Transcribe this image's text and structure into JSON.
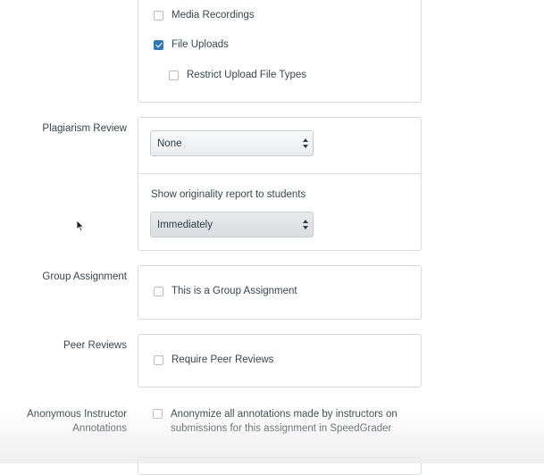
{
  "submission_types": {
    "media_recordings_label": "Media Recordings",
    "media_recordings_checked": false,
    "file_uploads_label": "File Uploads",
    "file_uploads_checked": true,
    "restrict_upload_label": "Restrict Upload File Types",
    "restrict_upload_checked": false
  },
  "plagiarism": {
    "label": "Plagiarism Review",
    "selected": "None",
    "originality_label": "Show originality report to students",
    "originality_selected": "Immediately"
  },
  "group_assignment": {
    "label": "Group Assignment",
    "checkbox_label": "This is a Group Assignment",
    "checked": false
  },
  "peer_reviews": {
    "label": "Peer Reviews",
    "checkbox_label": "Require Peer Reviews",
    "checked": false
  },
  "anonymous_annotations": {
    "label_line1": "Anonymous Instructor",
    "label_line2": "Annotations",
    "checkbox_label_line1": "Anonymize all annotations made by instructors on",
    "checkbox_label_line2": "submissions for this assignment in SpeedGrader",
    "checked": false
  },
  "colors": {
    "accent": "#2b7abc",
    "border": "#d8dcdf",
    "text": "#38454f"
  }
}
